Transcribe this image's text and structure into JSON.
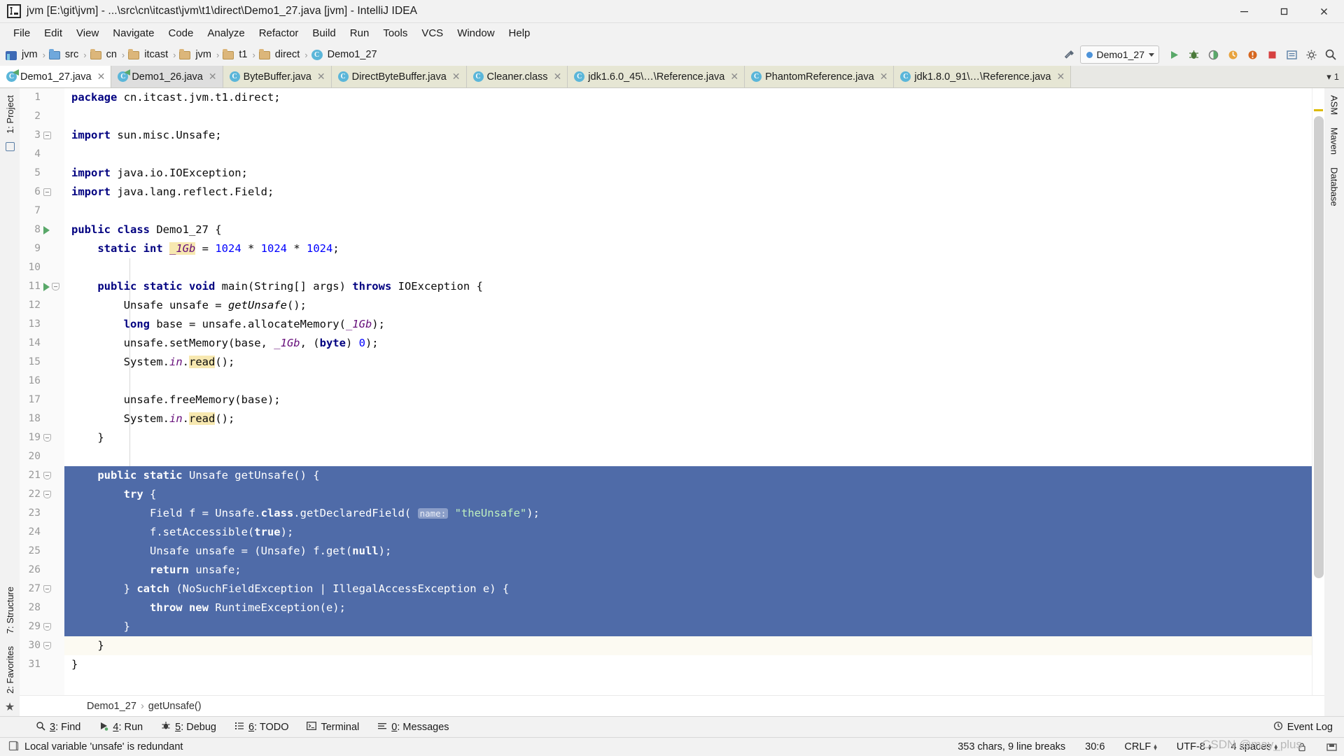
{
  "window": {
    "title": "jvm [E:\\git\\jvm] - ...\\src\\cn\\itcast\\jvm\\t1\\direct\\Demo1_27.java [jvm] - IntelliJ IDEA",
    "minimize": "—",
    "maximize": "▢",
    "close": "✕"
  },
  "menu": [
    "File",
    "Edit",
    "View",
    "Navigate",
    "Code",
    "Analyze",
    "Refactor",
    "Build",
    "Run",
    "Tools",
    "VCS",
    "Window",
    "Help"
  ],
  "breadcrumb": [
    {
      "label": "jvm",
      "icon": "module-icon"
    },
    {
      "label": "src",
      "icon": "folder-blue-icon"
    },
    {
      "label": "cn",
      "icon": "folder-icon"
    },
    {
      "label": "itcast",
      "icon": "folder-icon"
    },
    {
      "label": "jvm",
      "icon": "folder-icon"
    },
    {
      "label": "t1",
      "icon": "folder-icon"
    },
    {
      "label": "direct",
      "icon": "folder-icon"
    },
    {
      "label": "Demo1_27",
      "icon": "java-class-icon"
    }
  ],
  "toolbar": {
    "run_config": "Demo1_27",
    "icons": [
      "hammer-icon",
      "run-icon",
      "debug-icon",
      "coverage-icon",
      "profile-icon",
      "attach-icon",
      "stop-icon",
      "update-icon",
      "settings-icon",
      "search-icon"
    ]
  },
  "tabs": [
    {
      "label": "Demo1_27.java",
      "state": "active",
      "closable": true
    },
    {
      "label": "Demo1_26.java",
      "state": "plain",
      "closable": true
    },
    {
      "label": "ByteBuffer.java",
      "state": "modified",
      "closable": true
    },
    {
      "label": "DirectByteBuffer.java",
      "state": "modified",
      "closable": true
    },
    {
      "label": "Cleaner.class",
      "state": "modified",
      "closable": true
    },
    {
      "label": "jdk1.6.0_45\\…\\Reference.java",
      "state": "modified",
      "closable": true
    },
    {
      "label": "PhantomReference.java",
      "state": "modified",
      "closable": true
    },
    {
      "label": "jdk1.8.0_91\\…\\Reference.java",
      "state": "modified",
      "closable": true
    }
  ],
  "tabs_overflow": "1",
  "left_tool_tabs": [
    "1: Project",
    "7: Structure",
    "2: Favorites"
  ],
  "right_tool_tabs": [
    "ASM",
    "Maven",
    "Database"
  ],
  "editor": {
    "line_count": 31,
    "lines": [
      {
        "n": 1,
        "text": "package cn.itcast.jvm.t1.direct;"
      },
      {
        "n": 2,
        "text": ""
      },
      {
        "n": 3,
        "text": "import sun.misc.Unsafe;"
      },
      {
        "n": 4,
        "text": ""
      },
      {
        "n": 5,
        "text": "import java.io.IOException;"
      },
      {
        "n": 6,
        "text": "import java.lang.reflect.Field;"
      },
      {
        "n": 7,
        "text": ""
      },
      {
        "n": 8,
        "text": "public class Demo1_27 {"
      },
      {
        "n": 9,
        "text": "    static int _1Gb = 1024 * 1024 * 1024;"
      },
      {
        "n": 10,
        "text": ""
      },
      {
        "n": 11,
        "text": "    public static void main(String[] args) throws IOException {"
      },
      {
        "n": 12,
        "text": "        Unsafe unsafe = getUnsafe();"
      },
      {
        "n": 13,
        "text": "        long base = unsafe.allocateMemory(_1Gb);"
      },
      {
        "n": 14,
        "text": "        unsafe.setMemory(base, _1Gb, (byte) 0);"
      },
      {
        "n": 15,
        "text": "        System.in.read();"
      },
      {
        "n": 16,
        "text": ""
      },
      {
        "n": 17,
        "text": "        unsafe.freeMemory(base);"
      },
      {
        "n": 18,
        "text": "        System.in.read();"
      },
      {
        "n": 19,
        "text": "    }"
      },
      {
        "n": 20,
        "text": ""
      },
      {
        "n": 21,
        "text": "    public static Unsafe getUnsafe() {"
      },
      {
        "n": 22,
        "text": "        try {"
      },
      {
        "n": 23,
        "text": "            Field f = Unsafe.class.getDeclaredField( name: \"theUnsafe\");"
      },
      {
        "n": 24,
        "text": "            f.setAccessible(true);"
      },
      {
        "n": 25,
        "text": "            Unsafe unsafe = (Unsafe) f.get(null);"
      },
      {
        "n": 26,
        "text": "            return unsafe;"
      },
      {
        "n": 27,
        "text": "        } catch (NoSuchFieldException | IllegalAccessException e) {"
      },
      {
        "n": 28,
        "text": "            throw new RuntimeException(e);"
      },
      {
        "n": 29,
        "text": "        }"
      },
      {
        "n": 30,
        "text": "    }"
      },
      {
        "n": 31,
        "text": "}"
      }
    ],
    "param_hint": "name:",
    "selection_lines": [
      21,
      22,
      23,
      24,
      25,
      26,
      27,
      28,
      29,
      30
    ],
    "caret_line": 30,
    "run_gutter_lines": [
      8,
      11
    ],
    "fold_lines": [
      3,
      6,
      11,
      19,
      21,
      22,
      27,
      29,
      30
    ],
    "breadcrumb": [
      "Demo1_27",
      "getUnsafe()"
    ]
  },
  "bottom_tools": [
    {
      "key": "3",
      "label": "Find",
      "icon": "search-icon"
    },
    {
      "key": "4",
      "label": "Run",
      "icon": "run-icon"
    },
    {
      "key": "5",
      "label": "Debug",
      "icon": "debug-icon"
    },
    {
      "key": "6",
      "label": "TODO",
      "icon": "list-icon"
    },
    {
      "key": "",
      "label": "Terminal",
      "icon": "terminal-icon"
    },
    {
      "key": "0",
      "label": "Messages",
      "icon": "messages-icon"
    }
  ],
  "event_log": "Event Log",
  "status": {
    "message": "Local variable 'unsafe' is redundant",
    "chars": "353 chars, 9 line breaks",
    "caret_pos": "30:6",
    "line_sep": "CRLF",
    "encoding": "UTF-8",
    "indent": "4 spaces"
  },
  "watermark": "CSDN @may_plus",
  "colors": {
    "selection": "#4f6ba8",
    "keyword": "#000080",
    "number": "#0000ff",
    "string": "#008000",
    "field": "#660e7a",
    "tab_modified": "#e6e6d4",
    "accent": "#4d93d9",
    "run_green": "#59a869"
  }
}
